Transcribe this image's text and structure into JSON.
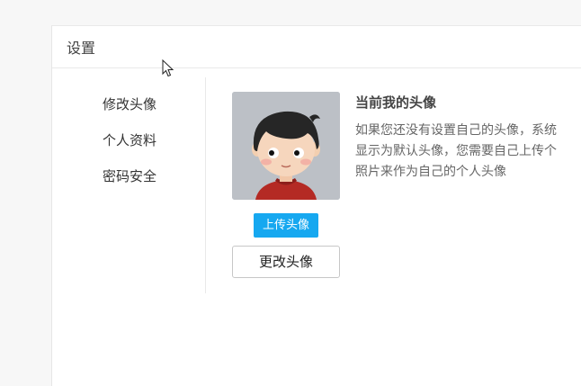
{
  "panel": {
    "title": "设置"
  },
  "sidebar": {
    "items": [
      {
        "label": "修改头像"
      },
      {
        "label": "个人资料"
      },
      {
        "label": "密码安全"
      }
    ]
  },
  "avatar": {
    "upload_label": "上传头像",
    "change_label": "更改头像",
    "upload_color": "#16a8f0"
  },
  "info": {
    "title": "当前我的头像",
    "lines": [
      "如果您还没有设置自己的头像，系统",
      "显示为默认头像，您需要自己上传个",
      "照片来作为自己的个人头像"
    ]
  },
  "icons": {
    "cursor": "mouse-pointer-icon",
    "avatar": "cartoon-boy-avatar"
  }
}
